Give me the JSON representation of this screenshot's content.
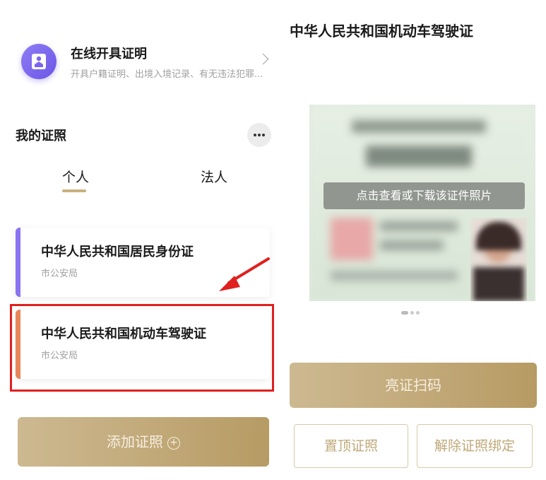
{
  "left": {
    "online_service": {
      "title": "在线开具证明",
      "subtitle": "开具户籍证明、出境入境记录、有无违法犯罪..."
    },
    "my_certificates": {
      "title": "我的证照"
    },
    "tabs": [
      {
        "label": "个人",
        "active": true
      },
      {
        "label": "法人",
        "active": false
      }
    ],
    "cards": [
      {
        "name": "中华人民共和国居民身份证",
        "issuer": "市公安局",
        "accent": "#8a74f0"
      },
      {
        "name": "中华人民共和国机动车驾驶证",
        "issuer": "市公安局",
        "accent": "#e8855a"
      }
    ],
    "add_button": {
      "label": "添加证照"
    }
  },
  "right": {
    "title": "中华人民共和国机动车驾驶证",
    "license_overlay": "点击查看或下载该证件照片",
    "carousel": {
      "count": 3,
      "active": 0
    },
    "show_qr_button": "亮证扫码",
    "pin_button": "置顶证照",
    "unbind_button": "解除证照绑定"
  },
  "colors": {
    "gold": "#c3a877",
    "highlight": "#e02020"
  }
}
